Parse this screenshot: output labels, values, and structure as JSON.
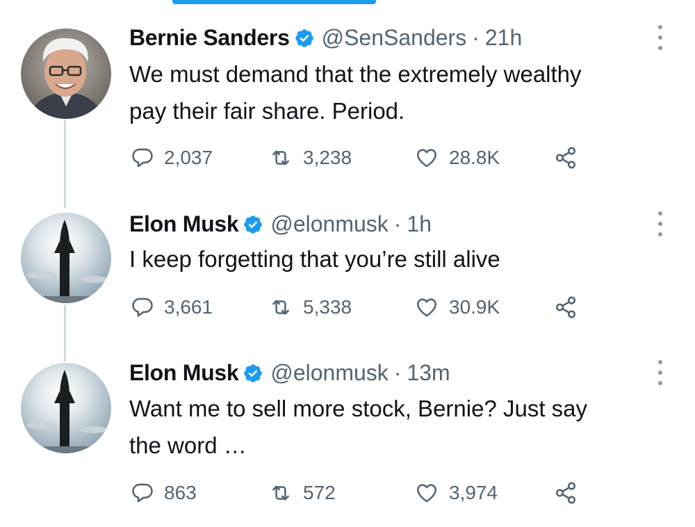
{
  "tweets": [
    {
      "name": "Bernie Sanders",
      "handle": "@SenSanders",
      "separator": "·",
      "time": "21h",
      "text": "We must demand that the extremely wealthy\npay their fair share. Period.",
      "replies": "2,037",
      "retweets": "3,238",
      "likes": "28.8K",
      "avatar": "bernie-sanders-photo"
    },
    {
      "name": "Elon Musk",
      "handle": "@elonmusk",
      "separator": "·",
      "time": "1h",
      "text": "I keep forgetting that you’re still alive",
      "replies": "3,661",
      "retweets": "5,338",
      "likes": "30.9K",
      "avatar": "starship-rocket-photo"
    },
    {
      "name": "Elon Musk",
      "handle": "@elonmusk",
      "separator": "·",
      "time": "13m",
      "text": "Want me to sell more stock, Bernie? Just say\nthe word …",
      "replies": "863",
      "retweets": "572",
      "likes": "3,974",
      "avatar": "starship-rocket-photo"
    }
  ],
  "icons": {
    "reply": "reply-icon",
    "retweet": "retweet-icon",
    "like": "heart-icon",
    "share": "share-icon",
    "verified": "verified-badge-icon",
    "more": "more-options-icon"
  },
  "colors": {
    "verified": "#1d9bf0",
    "secondary_text": "#536471",
    "thread_line": "#cfd9de"
  }
}
